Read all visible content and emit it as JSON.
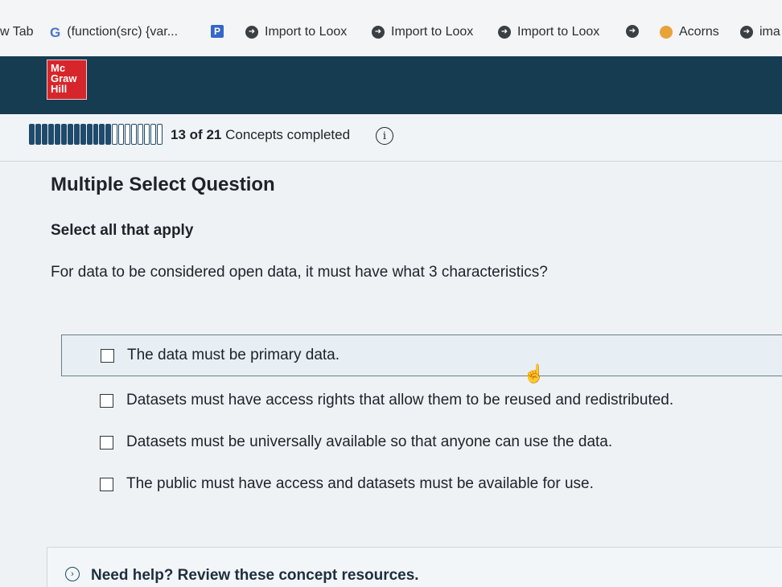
{
  "bookmarks": [
    {
      "label": "w Tab",
      "icon": "none"
    },
    {
      "label": "(function(src) {var...",
      "icon": "google-g-icon"
    },
    {
      "label": "",
      "icon": "p-icon"
    },
    {
      "label": "Import to Loox",
      "icon": "loox-icon"
    },
    {
      "label": "Import to Loox",
      "icon": "loox-icon"
    },
    {
      "label": "Import to Loox",
      "icon": "loox-icon"
    },
    {
      "label": "",
      "icon": "loox-icon"
    },
    {
      "label": "Acorns",
      "icon": "acorns-icon"
    },
    {
      "label": "ima",
      "icon": "loox-icon"
    }
  ],
  "logo": {
    "line1": "Mc",
    "line2": "Graw",
    "line3": "Hill"
  },
  "progress": {
    "completed": 13,
    "total": 21,
    "completed_text": "13",
    "total_text": "21",
    "of": "of",
    "suffix": "Concepts completed"
  },
  "question": {
    "type": "Multiple Select Question",
    "instruction": "Select all that apply",
    "prompt": "For data to be considered open data, it must have what 3 characteristics?"
  },
  "options": [
    "The data must be primary data.",
    "Datasets must have access rights that allow them to be reused and redistributed.",
    "Datasets must be universally available so that anyone can use the data.",
    "The public must have access and datasets must be available for use."
  ],
  "help": {
    "text": "Need help? Review these concept resources."
  },
  "colors": {
    "header": "#163c52",
    "progress": "#1f4a6b",
    "logo": "#d7262b"
  }
}
